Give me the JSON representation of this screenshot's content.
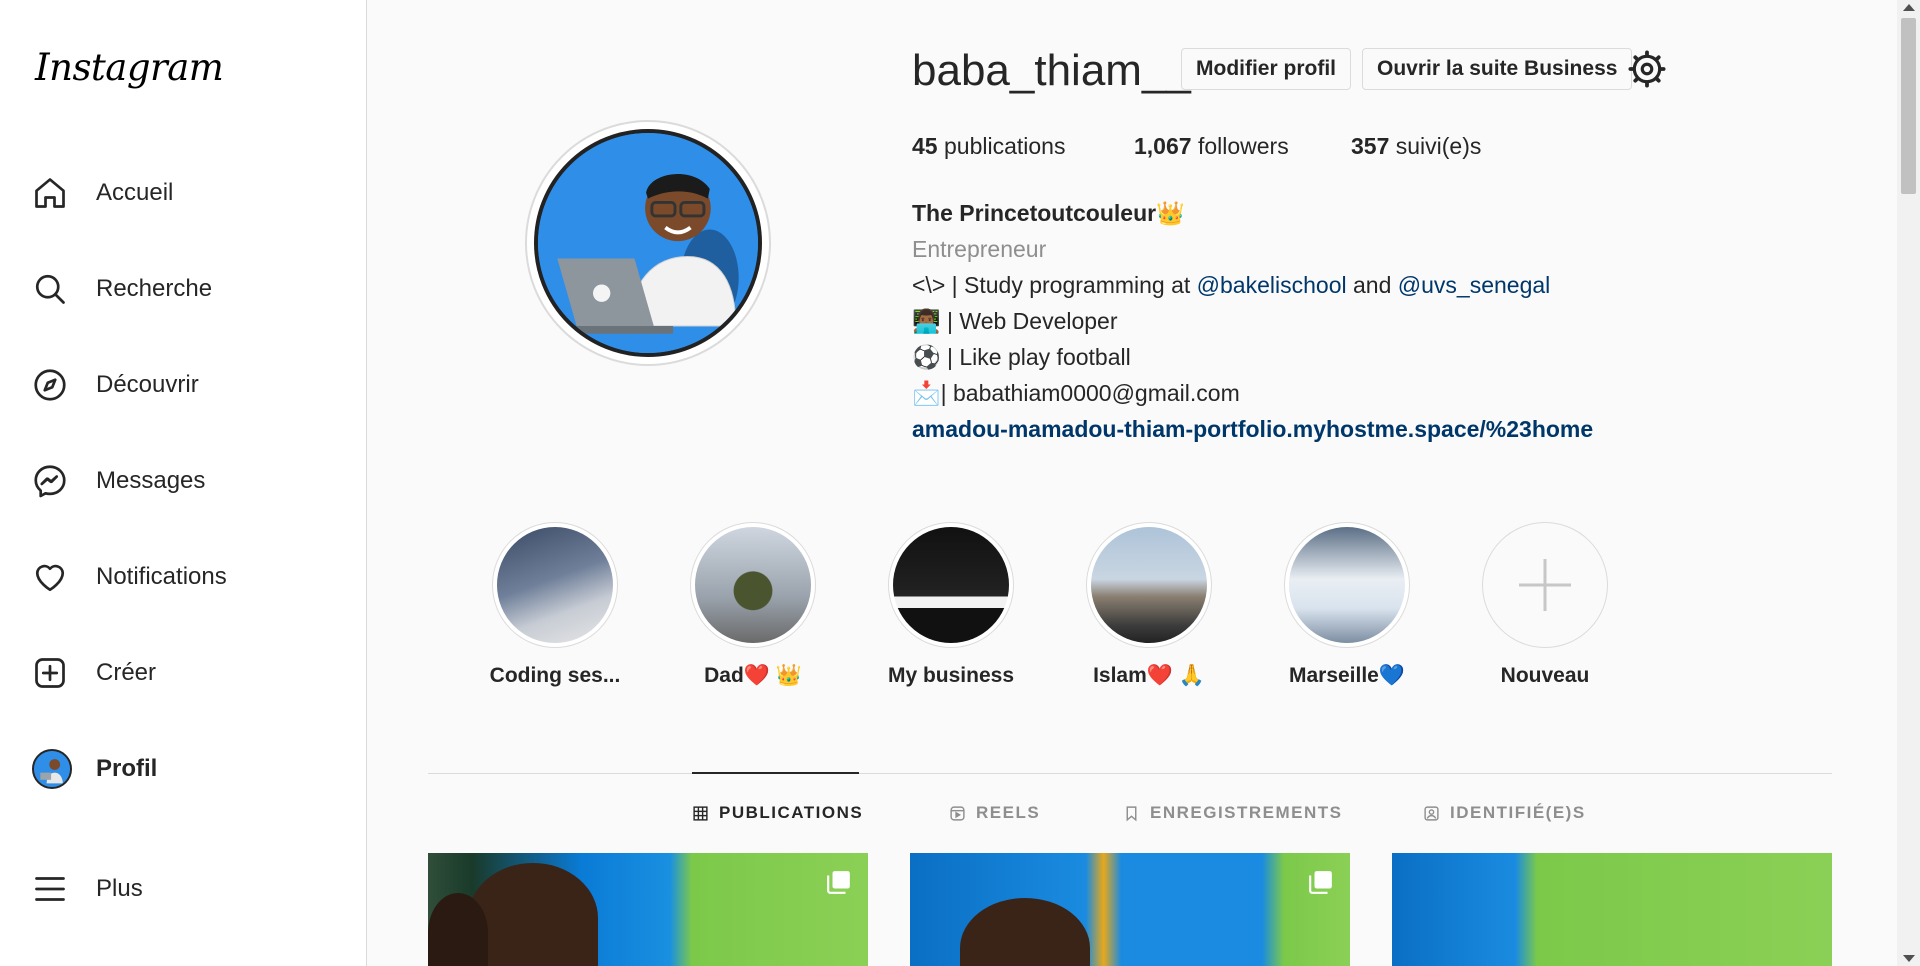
{
  "app": {
    "logo": "Instagram"
  },
  "sidebar": {
    "items": [
      {
        "label": "Accueil",
        "icon": "home-icon"
      },
      {
        "label": "Recherche",
        "icon": "search-icon"
      },
      {
        "label": "Découvrir",
        "icon": "compass-icon"
      },
      {
        "label": "Messages",
        "icon": "messenger-icon"
      },
      {
        "label": "Notifications",
        "icon": "heart-icon"
      },
      {
        "label": "Créer",
        "icon": "plus-square-icon"
      },
      {
        "label": "Profil",
        "icon": "avatar"
      },
      {
        "label": "Plus",
        "icon": "menu-icon"
      }
    ]
  },
  "profile": {
    "username": "baba_thiam__",
    "edit_button": "Modifier profil",
    "business_button": "Ouvrir la suite Business",
    "stats": {
      "posts_count": "45",
      "posts_label": "publications",
      "followers_count": "1,067",
      "followers_label": "followers",
      "following_count": "357",
      "following_label": "suivi(e)s"
    },
    "bio": {
      "name": "The Princetoutcouleur",
      "name_emoji": "👑",
      "category": "Entrepreneur",
      "line1_prefix": "<\\> | Study programming at ",
      "mention1": "@bakelischool",
      "line1_and": " and ",
      "mention2": "@uvs_senegal",
      "line2_emoji": "👨🏾‍💻",
      "line2_text": " | Web Developer",
      "line3_emoji": "⚽",
      "line3_text": " | Like play football",
      "line4_emoji": "📩",
      "line4_text": "| babathiam0000@gmail.com",
      "link": "amadou-mamadou-thiam-portfolio.myhostme.space/%23home"
    }
  },
  "highlights": [
    {
      "label": "Coding ses..."
    },
    {
      "label": "Dad❤️ 👑"
    },
    {
      "label": "My business"
    },
    {
      "label": "Islam❤️ 🙏"
    },
    {
      "label": "Marseille💙"
    },
    {
      "label": "Nouveau"
    }
  ],
  "tabs": [
    {
      "label": "PUBLICATIONS",
      "icon": "grid-icon",
      "active": true
    },
    {
      "label": "REELS",
      "icon": "reels-icon",
      "active": false
    },
    {
      "label": "ENREGISTREMENTS",
      "icon": "bookmark-icon",
      "active": false
    },
    {
      "label": "IDENTIFIÉ(E)S",
      "icon": "tagged-icon",
      "active": false
    }
  ],
  "colors": {
    "link": "#00376b",
    "muted": "#8e8e8e",
    "border": "#dbdbdb",
    "avatar_bg": "#2e8ee8"
  }
}
